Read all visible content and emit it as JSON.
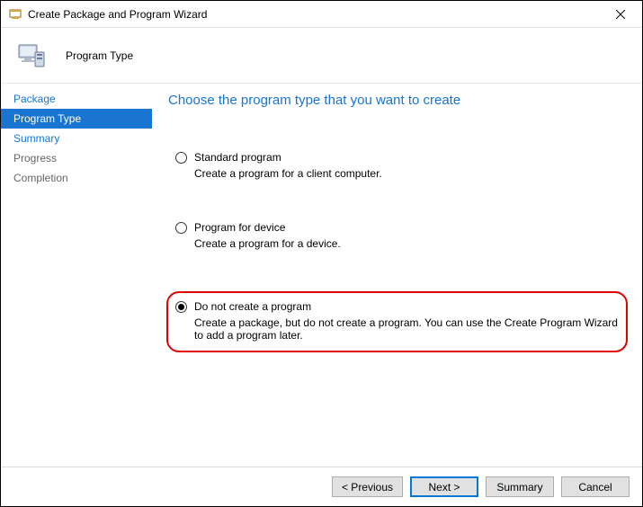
{
  "window": {
    "title": "Create Package and Program Wizard"
  },
  "header": {
    "title": "Program Type"
  },
  "sidebar": {
    "items": [
      {
        "label": "Package",
        "state": "done"
      },
      {
        "label": "Program Type",
        "state": "active"
      },
      {
        "label": "Summary",
        "state": "pending"
      },
      {
        "label": "Progress",
        "state": "pending"
      },
      {
        "label": "Completion",
        "state": "pending"
      }
    ]
  },
  "content": {
    "heading": "Choose the program type that you want to create",
    "options": [
      {
        "label": "Standard program",
        "desc": "Create a program for a client computer.",
        "checked": false
      },
      {
        "label": "Program for device",
        "desc": "Create a program for a device.",
        "checked": false
      },
      {
        "label": "Do not create a program",
        "desc": "Create a package, but do not create a program. You can use the Create Program Wizard to add a program later.",
        "checked": true,
        "highlighted": true
      }
    ]
  },
  "footer": {
    "previous": "< Previous",
    "next": "Next >",
    "summary": "Summary",
    "cancel": "Cancel"
  }
}
